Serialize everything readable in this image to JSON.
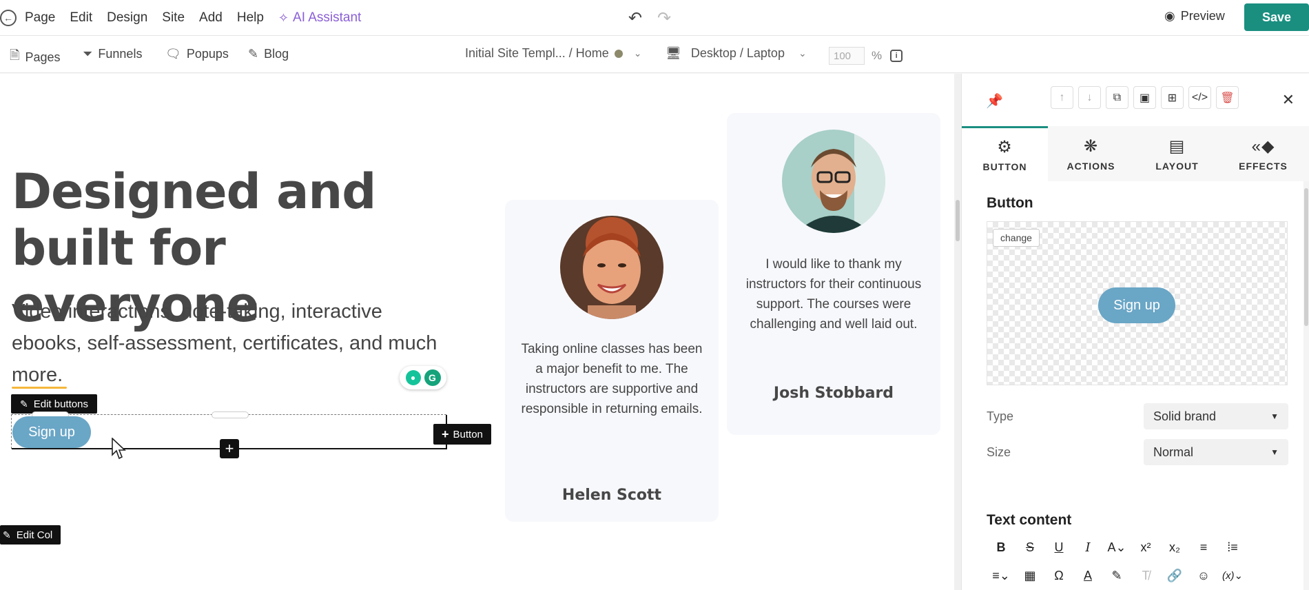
{
  "topbar": {
    "menu": [
      "Page",
      "Edit",
      "Design",
      "Site",
      "Add",
      "Help"
    ],
    "ai_assistant": "AI Assistant",
    "preview": "Preview",
    "save": "Save"
  },
  "toolbar": {
    "tabs": [
      "Pages",
      "Funnels",
      "Popups",
      "Blog"
    ],
    "site_path": "Initial Site Templ... / Home",
    "device": "Desktop / Laptop",
    "zoom_value": "100",
    "zoom_unit": "%"
  },
  "canvas": {
    "headline_line1": "Designed and",
    "headline_line2": "built for everyone",
    "subtext": "Video interactions, note-taking, interactive ebooks, self-assessment, certificates, and much more.",
    "edit_buttons": "Edit buttons",
    "signup_button": "Sign up",
    "add_button": "Button",
    "edit_col": "Edit Col",
    "testimonials": [
      {
        "quote": "Taking online classes has been a major benefit to me. The instructors are supportive and responsible in returning emails.",
        "name": "Helen Scott"
      },
      {
        "quote": "I would like to thank my instructors for their continuous support. The courses were challenging and well laid out.",
        "name": "Josh Stobbard"
      }
    ]
  },
  "panel": {
    "tabs": [
      "BUTTON",
      "ACTIONS",
      "LAYOUT",
      "EFFECTS"
    ],
    "active_tab": "BUTTON",
    "section_title": "Button",
    "change_label": "change",
    "preview_button": "Sign up",
    "type_label": "Type",
    "type_value": "Solid brand",
    "size_label": "Size",
    "size_value": "Normal",
    "text_content_title": "Text content"
  },
  "colors": {
    "brand_green": "#1a8f80",
    "button_blue": "#6aa6c6",
    "ai_purple": "#8a5fd6"
  }
}
